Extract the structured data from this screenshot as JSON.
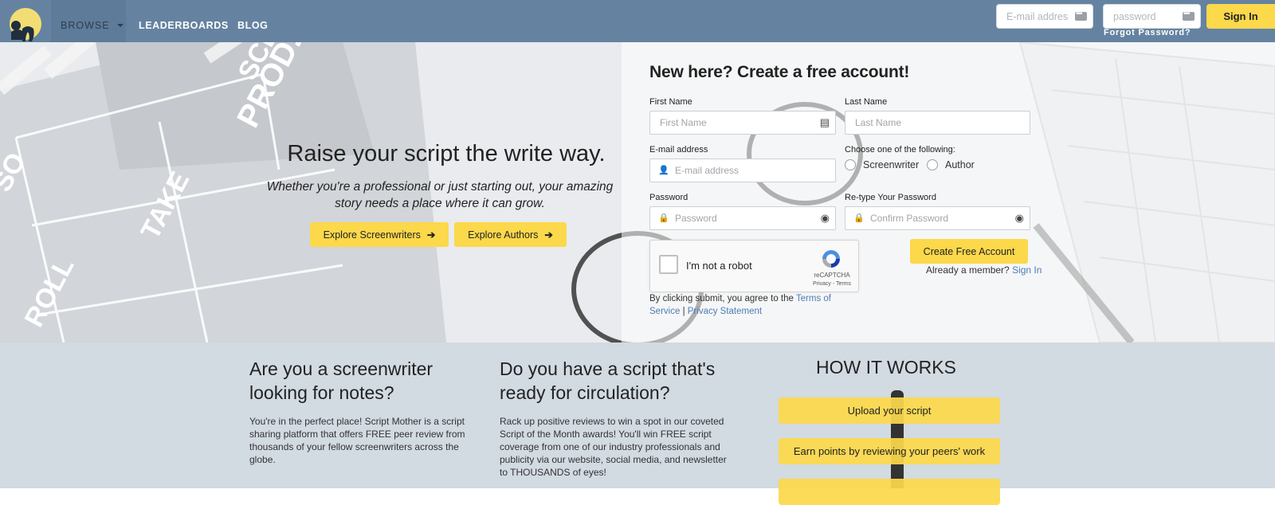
{
  "nav": {
    "links": {
      "browse": "BROWSE",
      "leaderboards": "LEADERBOARDS",
      "blog": "BLOG"
    },
    "login": {
      "email_placeholder": "E-mail address",
      "password_placeholder": "password",
      "signin_label": "Sign In",
      "forgot_label": "Forgot Password?"
    }
  },
  "hero": {
    "tagline": "Raise your script the write way.",
    "subtagline": "Whether you're a professional or just starting out, your amazing story needs a place where it can grow.",
    "buttons": {
      "screenwriters": "Explore Screenwriters",
      "authors": "Explore Authors"
    },
    "clapper_words": [
      "PROD.NO.",
      "SCENE",
      "TAKE",
      "ROLL",
      "SO"
    ]
  },
  "signup": {
    "title": "New here? Create a free account!",
    "first_name": {
      "label": "First Name",
      "placeholder": "First Name"
    },
    "last_name": {
      "label": "Last Name",
      "placeholder": "Last Name"
    },
    "email": {
      "label": "E-mail address",
      "placeholder": "E-mail address"
    },
    "role": {
      "label": "Choose one of the following:",
      "options": [
        "Screenwriter",
        "Author"
      ]
    },
    "password": {
      "label": "Password",
      "placeholder": "Password"
    },
    "confirm": {
      "label": "Re-type Your Password",
      "placeholder": "Confirm Password"
    },
    "captcha": {
      "text": "I'm not a robot",
      "brand": "reCAPTCHA",
      "links": "Privacy - Terms"
    },
    "create_label": "Create Free Account",
    "already_text": "Already a member?",
    "already_link": "Sign In",
    "terms_prefix": "By clicking submit, you agree to the",
    "terms_link": "Terms of Service",
    "terms_sep": "|",
    "privacy_link": "Privacy Statement"
  },
  "lower": {
    "col1": {
      "heading": "Are you a screenwriter looking for notes?",
      "text": "You're in the perfect place! Script Mother is a script sharing platform that offers FREE peer review from thousands of your fellow screenwriters across the globe."
    },
    "col2": {
      "heading": "Do you have a script that's ready for circulation?",
      "text": "Rack up positive reviews to win a spot in our coveted Script of the Month awards! You'll win FREE script coverage from one of our industry professionals and publicity via our website, social media, and newsletter to THOUSANDS of eyes!"
    },
    "how": {
      "heading": "HOW IT WORKS",
      "steps": [
        "Upload your script",
        "Earn points by reviewing your peers' work"
      ]
    }
  },
  "colors": {
    "nav": "#6583a1",
    "accent": "#fcd84b",
    "link": "#4f7db3",
    "lower_bg": "#d2dae2"
  }
}
